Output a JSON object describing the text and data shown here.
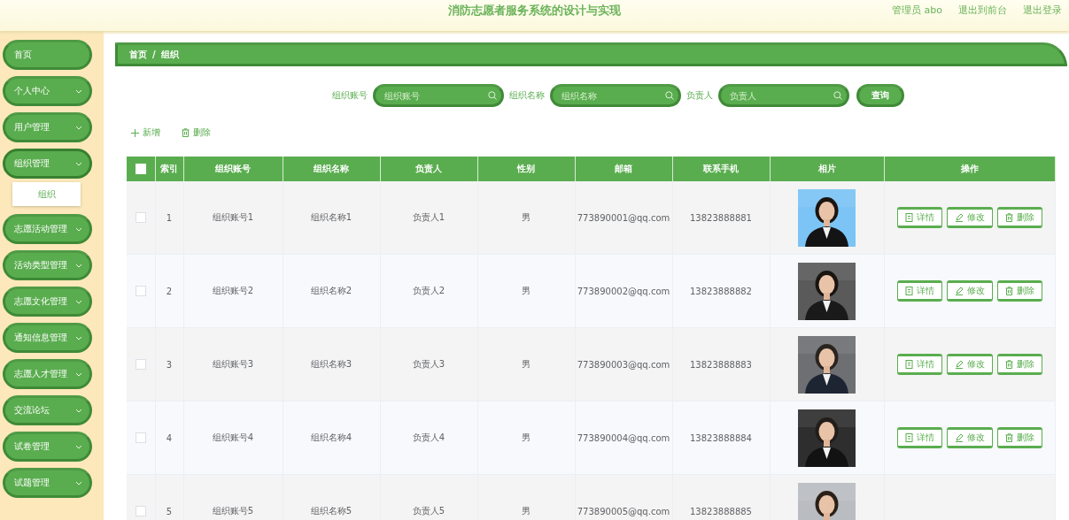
{
  "header": {
    "title": "消防志愿者服务系统的设计与实现",
    "links": [
      "管理员 abo",
      "退出到前台",
      "退出登录"
    ]
  },
  "sidebar": {
    "items": [
      {
        "label": "首页",
        "kind": "link"
      },
      {
        "label": "个人中心",
        "kind": "menu",
        "expanded": false
      },
      {
        "label": "用户管理",
        "kind": "menu",
        "expanded": false
      },
      {
        "label": "组织管理",
        "kind": "menu",
        "expanded": true,
        "children": [
          {
            "label": "组织"
          }
        ]
      },
      {
        "label": "志愿活动管理",
        "kind": "menu",
        "expanded": false
      },
      {
        "label": "活动类型管理",
        "kind": "menu",
        "expanded": false
      },
      {
        "label": "志愿文化管理",
        "kind": "menu",
        "expanded": false
      },
      {
        "label": "通知信息管理",
        "kind": "menu",
        "expanded": false
      },
      {
        "label": "志愿人才管理",
        "kind": "menu",
        "expanded": false
      },
      {
        "label": "交流论坛",
        "kind": "menu",
        "expanded": false
      },
      {
        "label": "试卷管理",
        "kind": "menu",
        "expanded": false
      },
      {
        "label": "试题管理",
        "kind": "menu",
        "expanded": false
      }
    ]
  },
  "breadcrumb": [
    "首页",
    "/",
    "组织"
  ],
  "search": {
    "fields": [
      {
        "label": "组织账号",
        "placeholder": "组织账号"
      },
      {
        "label": "组织名称",
        "placeholder": "组织名称"
      },
      {
        "label": "负责人",
        "placeholder": "负责人"
      }
    ],
    "button": "查询"
  },
  "toolbar": [
    {
      "kind": "add",
      "label": "新增"
    },
    {
      "kind": "delete",
      "label": "删除"
    }
  ],
  "table": {
    "select_all_checked": false,
    "columns": [
      "索引",
      "组织账号",
      "组织名称",
      "负责人",
      "性别",
      "邮箱",
      "联系手机",
      "相片",
      "操作"
    ],
    "rows": [
      {
        "checked": false,
        "cells": [
          "1",
          "组织账号1",
          "组织名称1",
          "负责人1",
          "男",
          "773890001@qq.com",
          "13823888881"
        ],
        "photo": {
          "kind": "picture"
        },
        "actions": [
          {
            "kind": "detail",
            "label": "详情"
          },
          {
            "kind": "edit",
            "label": "修改"
          },
          {
            "kind": "delete",
            "label": "删除"
          }
        ]
      },
      {
        "checked": false,
        "cells": [
          "2",
          "组织账号2",
          "组织名称2",
          "负责人2",
          "男",
          "773890002@qq.com",
          "13823888882"
        ],
        "photo": {
          "kind": "picture"
        },
        "actions": [
          {
            "kind": "detail",
            "label": "详情"
          },
          {
            "kind": "edit",
            "label": "修改"
          },
          {
            "kind": "delete",
            "label": "删除"
          }
        ]
      },
      {
        "checked": false,
        "cells": [
          "3",
          "组织账号3",
          "组织名称3",
          "负责人3",
          "男",
          "773890003@qq.com",
          "13823888883"
        ],
        "photo": {
          "kind": "picture"
        },
        "actions": [
          {
            "kind": "detail",
            "label": "详情"
          },
          {
            "kind": "edit",
            "label": "修改"
          },
          {
            "kind": "delete",
            "label": "删除"
          }
        ]
      },
      {
        "checked": false,
        "cells": [
          "4",
          "组织账号4",
          "组织名称4",
          "负责人4",
          "男",
          "773890004@qq.com",
          "13823888884"
        ],
        "photo": {
          "kind": "picture"
        },
        "actions": [
          {
            "kind": "detail",
            "label": "详情"
          },
          {
            "kind": "edit",
            "label": "修改"
          },
          {
            "kind": "delete",
            "label": "删除"
          }
        ]
      },
      {
        "checked": false,
        "cells": [
          "5",
          "组织账号5",
          "组织名称5",
          "负责人5",
          "男",
          "773890005@qq.com",
          "13823888885"
        ],
        "photo": {
          "kind": "picture"
        },
        "actions": []
      }
    ]
  }
}
